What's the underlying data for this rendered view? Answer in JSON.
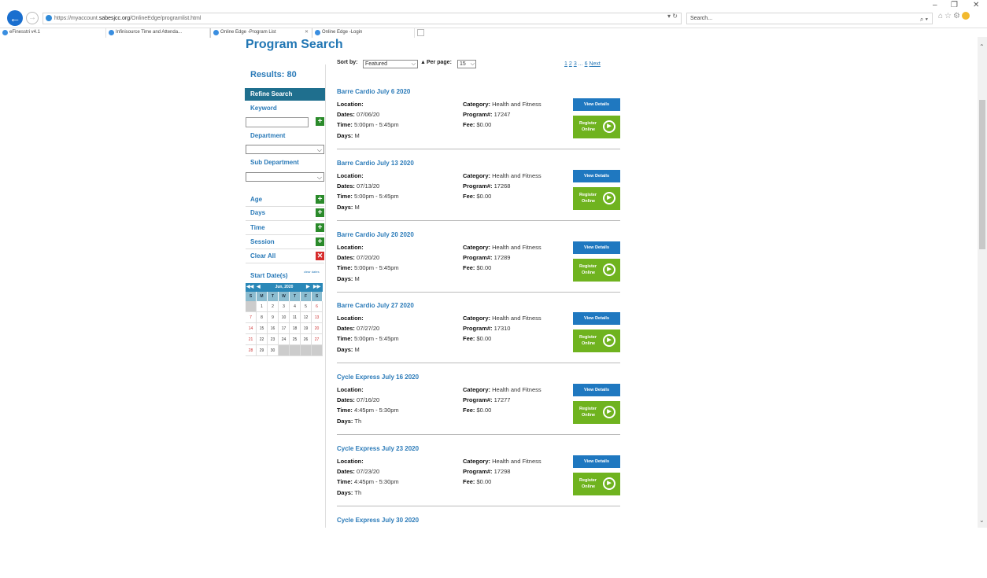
{
  "browser": {
    "url_prefix": "https://myaccount.",
    "url_domain": "sabesjcc.org",
    "url_path": "/OnlineEdge/programlist.html",
    "search_placeholder": "Search...",
    "tabs": [
      {
        "label": "eFinesstri v4.1",
        "active": false
      },
      {
        "label": "Infinisource Time and Attenda...",
        "active": false
      },
      {
        "label": "Online Edge -Program List",
        "active": true
      },
      {
        "label": "Online Edge -Login",
        "active": false
      }
    ]
  },
  "page": {
    "title": "Program Search",
    "results_label": "Results: 80"
  },
  "sidebar": {
    "refine": "Refine Search",
    "keyword": "Keyword",
    "department": "Department",
    "sub_department": "Sub Department",
    "filters": [
      {
        "label": "Age"
      },
      {
        "label": "Days"
      },
      {
        "label": "Time"
      },
      {
        "label": "Session"
      }
    ],
    "clear_all": "Clear All",
    "start_dates": "Start Date(s)",
    "clear_dates": "clear dates",
    "calendar": {
      "month": "Jun, 2020",
      "dow": [
        "S",
        "M",
        "T",
        "W",
        "T",
        "F",
        "S"
      ],
      "days": [
        "",
        "1",
        "2",
        "3",
        "4",
        "5",
        "6",
        "7",
        "8",
        "9",
        "10",
        "11",
        "12",
        "13",
        "14",
        "15",
        "16",
        "17",
        "18",
        "19",
        "20",
        "21",
        "22",
        "23",
        "24",
        "25",
        "26",
        "27",
        "28",
        "29",
        "30",
        "",
        "",
        "",
        ""
      ]
    }
  },
  "toolbar": {
    "sort_label": "Sort by:",
    "sort_value": "Featured",
    "per_page_label": "Per page:",
    "per_page_value": "15",
    "pages": [
      "1",
      "2",
      "3",
      "...",
      "6",
      "Next"
    ]
  },
  "labels": {
    "location": "Location:",
    "dates": "Dates:",
    "time": "Time:",
    "days": "Days:",
    "category": "Category:",
    "program": "Program#:",
    "fee": "Fee:",
    "view_details": "View Details",
    "register_line1": "Register",
    "register_line2": "Online"
  },
  "programs": [
    {
      "title": "Barre Cardio  July 6 2020",
      "dates": "07/06/20",
      "time": "5:00pm - 5:45pm",
      "days": "M",
      "category": "Health and Fitness",
      "program": "17247",
      "fee": "$0.00"
    },
    {
      "title": "Barre Cardio July 13 2020",
      "dates": "07/13/20",
      "time": "5:00pm - 5:45pm",
      "days": "M",
      "category": "Health and Fitness",
      "program": "17268",
      "fee": "$0.00"
    },
    {
      "title": "Barre Cardio July 20 2020",
      "dates": "07/20/20",
      "time": "5:00pm - 5:45pm",
      "days": "M",
      "category": "Health and Fitness",
      "program": "17289",
      "fee": "$0.00"
    },
    {
      "title": "Barre Cardio July 27 2020",
      "dates": "07/27/20",
      "time": "5:00pm - 5:45pm",
      "days": "M",
      "category": "Health and Fitness",
      "program": "17310",
      "fee": "$0.00"
    },
    {
      "title": "Cycle Express July 16 2020",
      "dates": "07/16/20",
      "time": "4:45pm - 5:30pm",
      "days": "Th",
      "category": "Health and Fitness",
      "program": "17277",
      "fee": "$0.00"
    },
    {
      "title": "Cycle Express July 23 2020",
      "dates": "07/23/20",
      "time": "4:45pm - 5:30pm",
      "days": "Th",
      "category": "Health and Fitness",
      "program": "17298",
      "fee": "$0.00"
    },
    {
      "title": "Cycle Express July 30 2020"
    }
  ],
  "colors": {
    "title_blue": "#2277b4",
    "refine_bg": "#1f6f8e",
    "view_btn": "#1f78c0",
    "register_btn": "#6fb31f",
    "plus_green": "#2a8a2a",
    "clear_red": "#d62c2c"
  }
}
